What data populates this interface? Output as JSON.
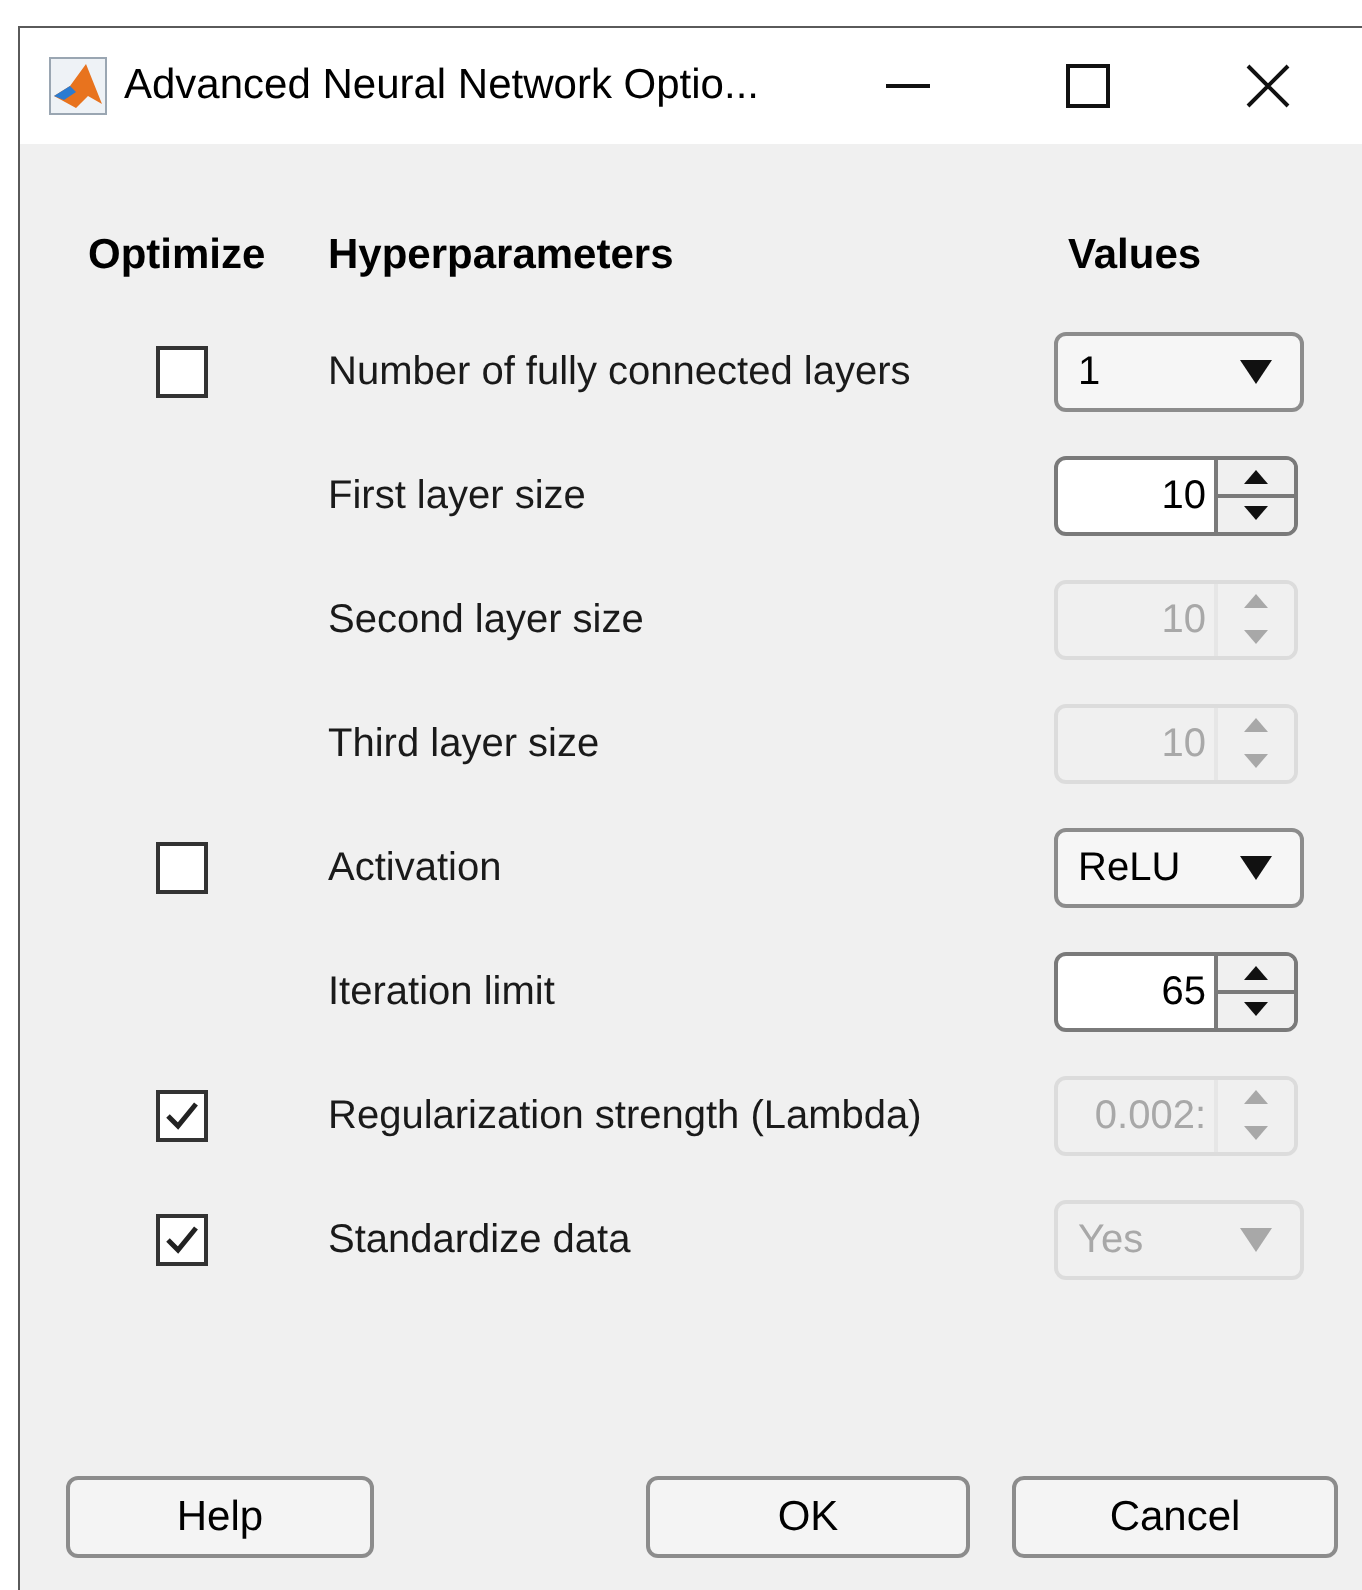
{
  "window": {
    "title": "Advanced Neural Network Optio..."
  },
  "columns": [
    "Optimize",
    "Hyperparameters",
    "Values"
  ],
  "rows": [
    {
      "optimize": {
        "checked": false
      },
      "label": "Number of fully connected layers",
      "control": {
        "kind": "dropdown",
        "value": "1",
        "disabled": false
      }
    },
    {
      "label": "First layer size",
      "control": {
        "kind": "spinner",
        "value": "10",
        "disabled": false
      }
    },
    {
      "label": "Second layer size",
      "control": {
        "kind": "spinner",
        "value": "10",
        "disabled": true
      }
    },
    {
      "label": "Third layer size",
      "control": {
        "kind": "spinner",
        "value": "10",
        "disabled": true
      }
    },
    {
      "optimize": {
        "checked": false
      },
      "label": "Activation",
      "control": {
        "kind": "dropdown",
        "value": "ReLU",
        "disabled": false
      }
    },
    {
      "label": "Iteration limit",
      "control": {
        "kind": "spinner",
        "value": "65",
        "disabled": false
      }
    },
    {
      "optimize": {
        "checked": true
      },
      "label": "Regularization strength (Lambda)",
      "control": {
        "kind": "spinner",
        "value": "0.002:",
        "disabled": true
      }
    },
    {
      "optimize": {
        "checked": true
      },
      "label": "Standardize data",
      "control": {
        "kind": "dropdown",
        "value": "Yes",
        "disabled": true
      }
    }
  ],
  "buttons": [
    "Help",
    "OK",
    "Cancel"
  ]
}
